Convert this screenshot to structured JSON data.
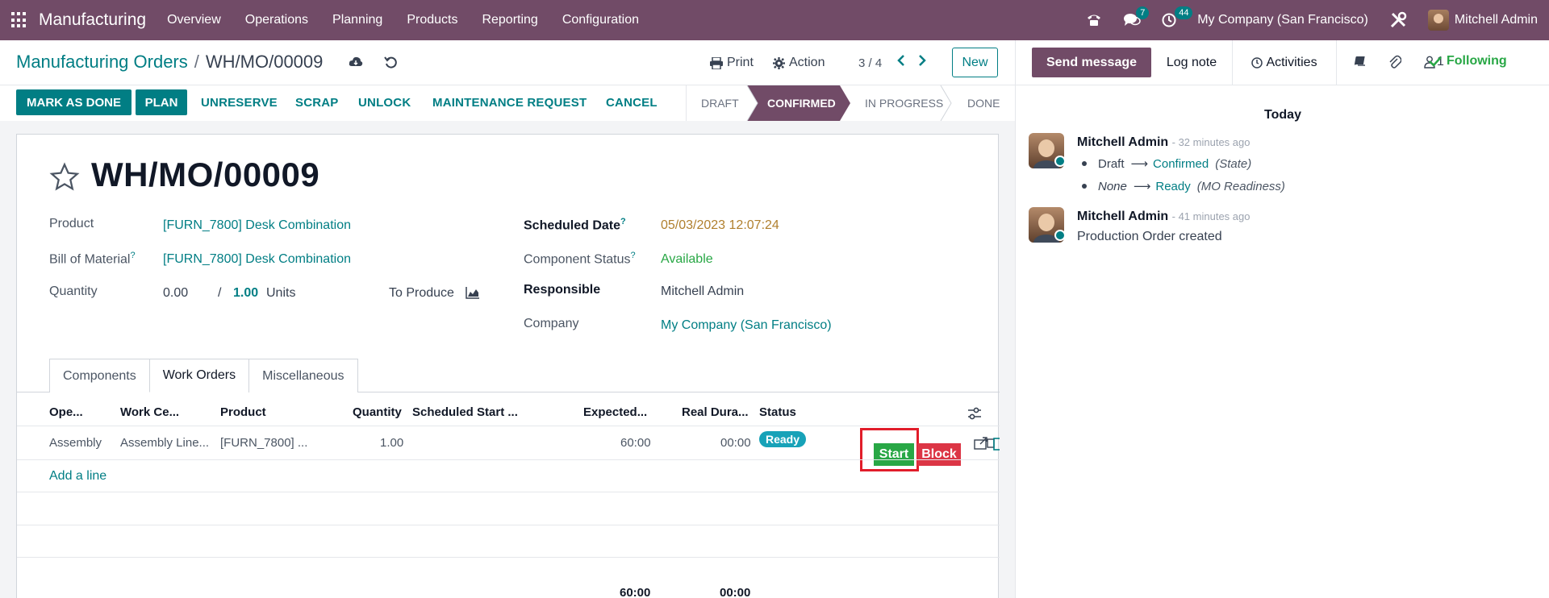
{
  "navbar": {
    "app_name": "Manufacturing",
    "menu": [
      "Overview",
      "Operations",
      "Planning",
      "Products",
      "Reporting",
      "Configuration"
    ],
    "messages_badge": "7",
    "activities_badge": "44",
    "company": "My Company (San Francisco)",
    "user": "Mitchell Admin"
  },
  "control": {
    "breadcrumb_parent": "Manufacturing Orders",
    "breadcrumb_sep": "/",
    "breadcrumb_current": "WH/MO/00009",
    "print_label": "Print",
    "action_label": "Action",
    "pager": "3 / 4",
    "new_label": "New"
  },
  "actions": {
    "mark_done": "MARK AS DONE",
    "plan": "PLAN",
    "unreserve": "UNRESERVE",
    "scrap": "SCRAP",
    "unlock": "UNLOCK",
    "maintenance": "MAINTENANCE REQUEST",
    "cancel": "CANCEL"
  },
  "stages": [
    "DRAFT",
    "CONFIRMED",
    "IN PROGRESS",
    "DONE"
  ],
  "form": {
    "title": "WH/MO/00009",
    "product_label": "Product",
    "product_value": "[FURN_7800] Desk Combination",
    "bom_label": "Bill of Material",
    "bom_value": "[FURN_7800] Desk Combination",
    "quantity_label": "Quantity",
    "quantity_produced": "0.00",
    "quantity_sep": "/",
    "quantity_total": "1.00",
    "quantity_unit": "Units",
    "to_produce_label": "To Produce",
    "scheduled_date_label": "Scheduled Date",
    "scheduled_date_value": "05/03/2023 12:07:24",
    "component_status_label": "Component Status",
    "component_status_value": "Available",
    "responsible_label": "Responsible",
    "responsible_value": "Mitchell Admin",
    "company_label": "Company",
    "company_value": "My Company (San Francisco)",
    "question_mark": "?"
  },
  "tabs": [
    "Components",
    "Work Orders",
    "Miscellaneous"
  ],
  "table": {
    "headers": [
      "Ope...",
      "Work Ce...",
      "Product",
      "Quantity",
      "Scheduled Start ...",
      "Expected...",
      "Real Dura...",
      "Status"
    ],
    "row": {
      "operation": "Assembly",
      "work_center": "Assembly Line...",
      "product": "[FURN_7800] ...",
      "quantity": "1.00",
      "expected": "60:00",
      "real": "00:00",
      "status": "Ready",
      "start_label": "Start",
      "block_label": "Block"
    },
    "add_line": "Add a line",
    "total_expected": "60:00",
    "total_real": "00:00"
  },
  "chatter": {
    "send_message": "Send message",
    "log_note": "Log note",
    "activities": "Activities",
    "followers": "1",
    "following": "Following",
    "today": "Today",
    "messages": [
      {
        "author": "Mitchell Admin",
        "time": "- 32 minutes ago",
        "changes": [
          {
            "old": "Draft",
            "arrow": "⟶",
            "new": "Confirmed",
            "field": "(State)"
          },
          {
            "old": "None",
            "arrow": "⟶",
            "new": "Ready",
            "field": "(MO Readiness)"
          }
        ]
      },
      {
        "author": "Mitchell Admin",
        "time": "- 41 minutes ago",
        "body": "Production Order created"
      }
    ]
  },
  "colors": {
    "brand": "#714b67",
    "accent": "#017e84",
    "ready": "#17a2b8",
    "start": "#28a745",
    "block": "#dc3545",
    "highlight": "#e11d2a"
  }
}
